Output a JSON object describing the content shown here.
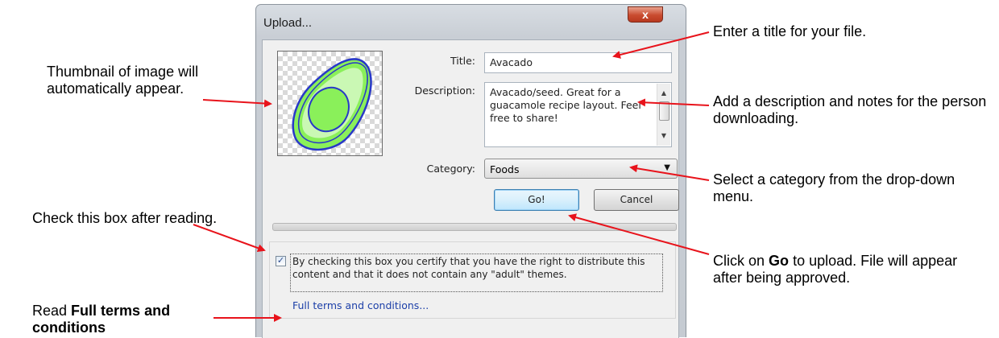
{
  "dialog": {
    "title": "Upload...",
    "close_glyph": "x",
    "title_label": "Title:",
    "title_value": "Avacado",
    "description_label": "Description:",
    "description_value": "Avacado/seed. Great for a guacamole recipe layout. Feel free to share!",
    "category_label": "Category:",
    "category_value": "Foods",
    "go_label": "Go!",
    "cancel_label": "Cancel",
    "certify_checked": true,
    "certify_text": "By checking this box you certify that you have the right to distribute this content and that it does not contain any \"adult\" themes.",
    "terms_link": "Full terms and conditions..."
  },
  "annotations": {
    "thumbnail": "Thumbnail of image will automatically appear.",
    "title": "Enter a title for your file.",
    "description": "Add a description and notes for the person downloading.",
    "category": "Select a category from the drop-down menu.",
    "checkbox": "Check this box after reading.",
    "go_prefix": "Click on",
    "go_bold": "Go",
    "go_suffix": "to upload. File will appear after being approved.",
    "terms_prefix": "Read",
    "terms_bold": "Full terms and conditions"
  },
  "colors": {
    "arrow": "#e8131b",
    "avocado_outline": "#2838c8",
    "avocado_fill": "#8af05a",
    "link": "#1c3fa8"
  },
  "icons": [
    "close-icon",
    "checkbox-check-icon",
    "dropdown-arrow-icon",
    "scroll-up-icon",
    "scroll-down-icon"
  ]
}
